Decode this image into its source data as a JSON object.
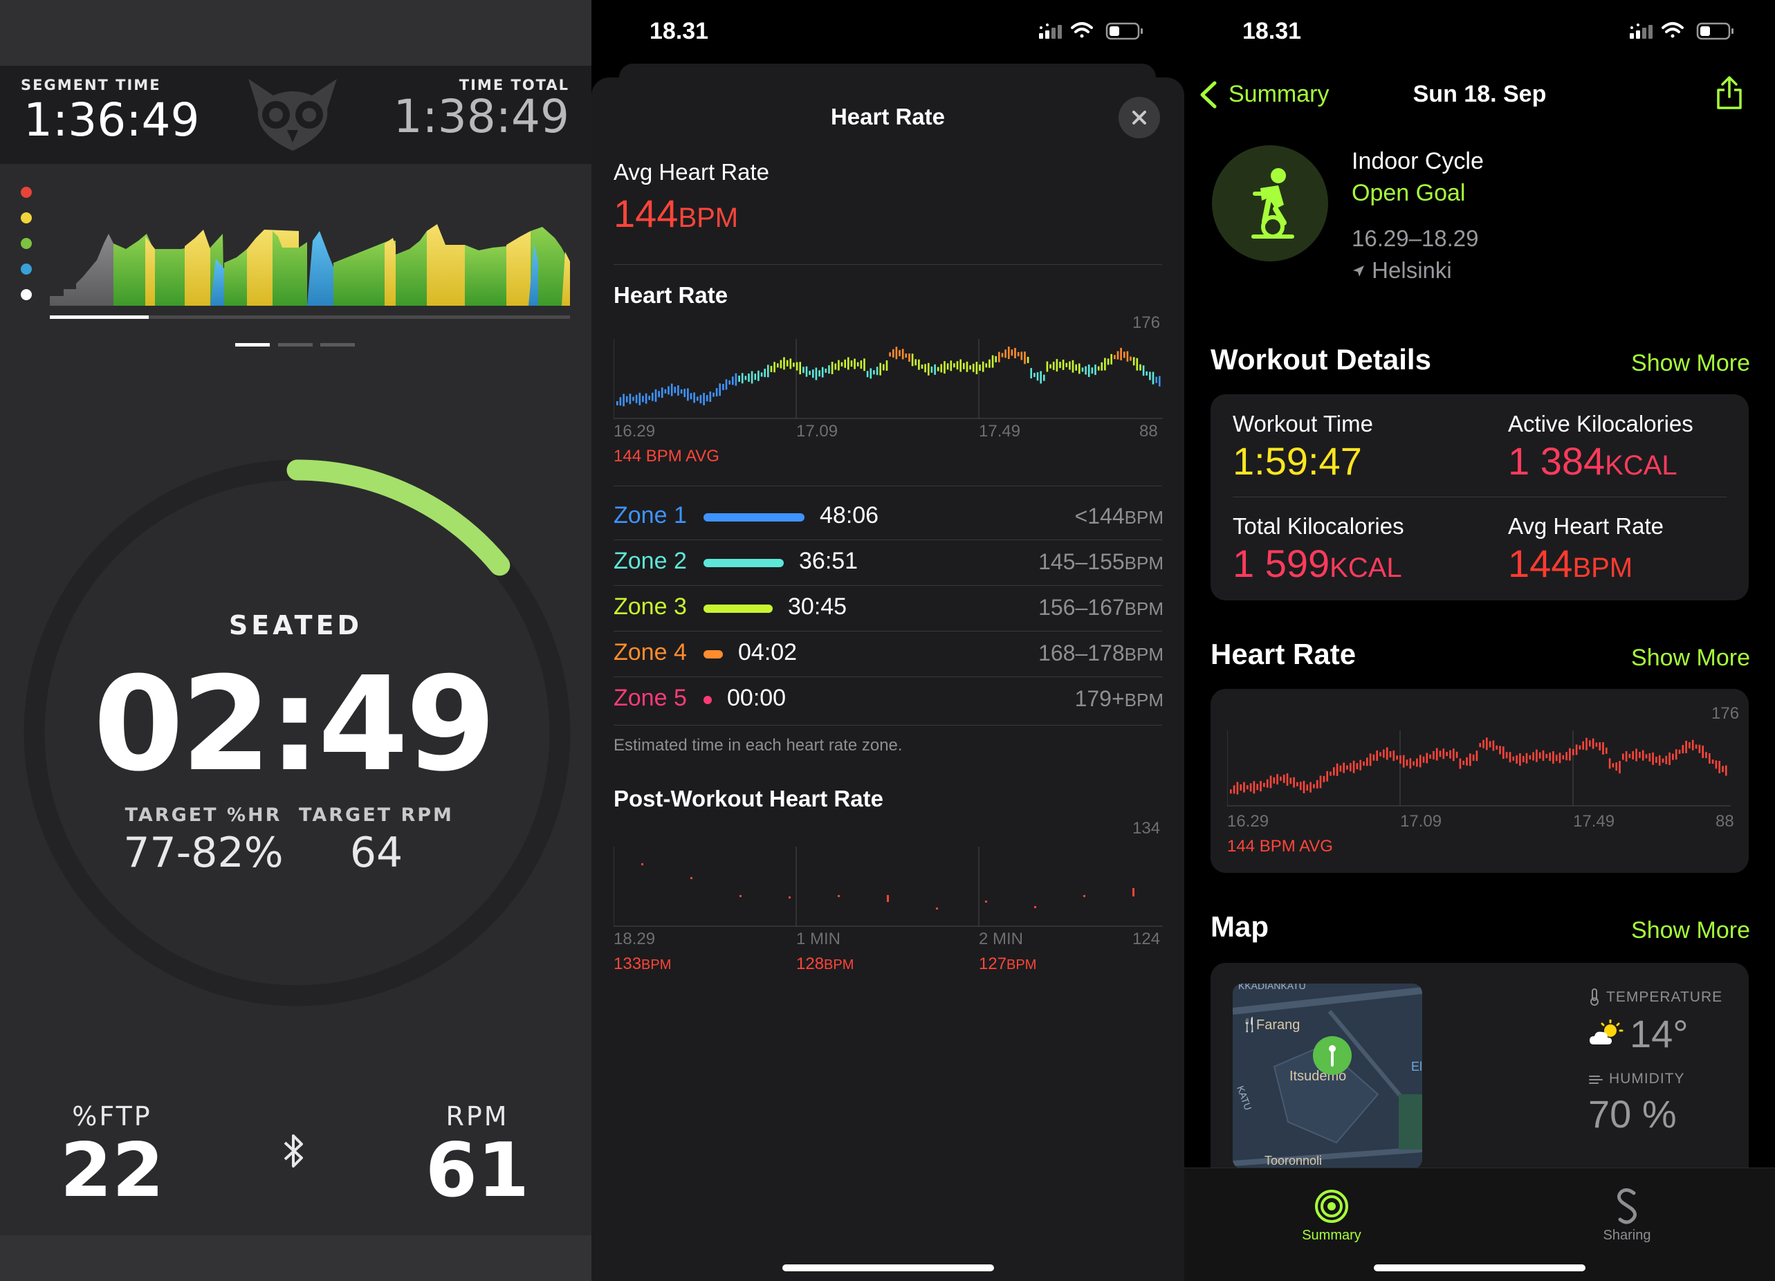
{
  "cycle_app": {
    "segment_time_label": "SEGMENT TIME",
    "segment_time": "1:36:49",
    "time_total_label": "TIME TOTAL",
    "time_total": "1:38:49",
    "zone_colors": [
      "#e8443a",
      "#f2d53c",
      "#7ec242",
      "#3aa0d8",
      "#ffffff"
    ],
    "session_progress_fraction": 0.19,
    "pager": {
      "count": 3,
      "active_index": 0
    },
    "ring_progress_fraction": 0.14,
    "position_label": "SEATED",
    "interval_remaining": "02:49",
    "target_hr_label": "TARGET %HR",
    "target_hr_value": "77-82%",
    "target_rpm_label": "TARGET RPM",
    "target_rpm_value": "64",
    "ftp_label": "%FTP",
    "ftp_value": "22",
    "rpm_label": "RPM",
    "rpm_value": "61",
    "bluetooth_icon": "bluetooth-icon"
  },
  "heart_rate_sheet": {
    "clock": "18.31",
    "title": "Heart Rate",
    "avg_label": "Avg Heart Rate",
    "avg_value": "144",
    "avg_unit": "BPM",
    "chart_title": "Heart Rate",
    "chart_max": "176",
    "chart_min": "88",
    "chart_x_labels": [
      "16.29",
      "17.09",
      "17.49"
    ],
    "chart_avg_note": "144 BPM AVG",
    "zones": [
      {
        "name": "Zone 1",
        "time": "48:06",
        "range": "<144",
        "unit": "BPM",
        "color": "#3f93ff"
      },
      {
        "name": "Zone 2",
        "time": "36:51",
        "range": "145–155",
        "unit": "BPM",
        "color": "#5ee7d8"
      },
      {
        "name": "Zone 3",
        "time": "30:45",
        "range": "156–167",
        "unit": "BPM",
        "color": "#c9f530"
      },
      {
        "name": "Zone 4",
        "time": "04:02",
        "range": "168–178",
        "unit": "BPM",
        "color": "#ff8c2e"
      },
      {
        "name": "Zone 5",
        "time": "00:00",
        "range": "179+",
        "unit": "BPM",
        "color": "#ff3b77"
      }
    ],
    "zones_note": "Estimated time in each heart rate zone.",
    "post_title": "Post-Workout Heart Rate",
    "post_max": "134",
    "post_min": "124",
    "post_points": [
      {
        "label": "18.29",
        "value": "133",
        "unit": "BPM"
      },
      {
        "label": "1 MIN",
        "value": "128",
        "unit": "BPM"
      },
      {
        "label": "2 MIN",
        "value": "127",
        "unit": "BPM"
      }
    ]
  },
  "summary": {
    "clock": "18.31",
    "back_label": "Summary",
    "date_title": "Sun 18. Sep",
    "workout_name": "Indoor Cycle",
    "goal": "Open Goal",
    "time_range": "16.29–18.29",
    "location": "Helsinki",
    "details_header": "Workout Details",
    "show_more": "Show More",
    "details": {
      "workout_time_label": "Workout Time",
      "workout_time": "1:59:47",
      "active_kcal_label": "Active Kilocalories",
      "active_kcal": "1 384",
      "total_kcal_label": "Total Kilocalories",
      "total_kcal": "1 599",
      "kcal_unit": "KCAL",
      "avg_hr_label": "Avg Heart Rate",
      "avg_hr": "144",
      "hr_unit": "BPM"
    },
    "hr_header": "Heart Rate",
    "hr_chart_max": "176",
    "hr_chart_min": "88",
    "hr_x_labels": [
      "16.29",
      "17.09",
      "17.49"
    ],
    "hr_avg_note": "144 BPM AVG",
    "map_header": "Map",
    "map_labels": {
      "street_top": "KKADIANKATU",
      "place1": "Farang",
      "place2": "Itsudemo",
      "place3": "El",
      "street_side": "KATU",
      "place4": "Tooronnoli"
    },
    "temperature_label": "TEMPERATURE",
    "temperature": "14°",
    "humidity_label": "HUMIDITY",
    "humidity": "70 %",
    "tabs": [
      "Summary",
      "Sharing"
    ],
    "accent": "#a7ff3b"
  }
}
